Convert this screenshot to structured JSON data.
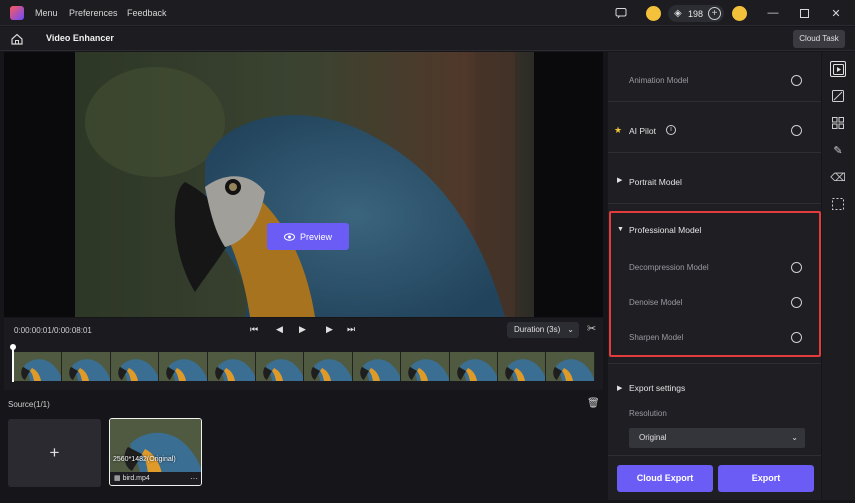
{
  "titlebar": {
    "menu": [
      "Menu",
      "Preferences",
      "Feedback"
    ],
    "credits": "198"
  },
  "toolbar": {
    "title": "Video Enhancer",
    "cloud_task": "Cloud Task"
  },
  "preview": {
    "button_label": "Preview"
  },
  "timeline": {
    "time": "0:00:00:01/0:00:08:01",
    "duration": "Duration (3s)"
  },
  "source": {
    "title": "Source(1/1)",
    "add_label": "+",
    "media": {
      "resolution": "2560*1482(Original)",
      "filename": "bird.mp4",
      "more": "···"
    }
  },
  "panel": {
    "animation_model": "Animation Model",
    "ai_pilot": "AI Pilot",
    "portrait_model": "Portrait Model",
    "professional_model": "Professional Model",
    "decompression_model": "Decompression Model",
    "denoise_model": "Denoise Model",
    "sharpen_model": "Sharpen Model",
    "export_settings": "Export settings",
    "resolution_label": "Resolution",
    "resolution_value": "Original",
    "cloud_export": "Cloud Export",
    "export": "Export"
  },
  "colors": {
    "accent": "#6b5cf5",
    "highlight_border": "#e23c3c"
  }
}
